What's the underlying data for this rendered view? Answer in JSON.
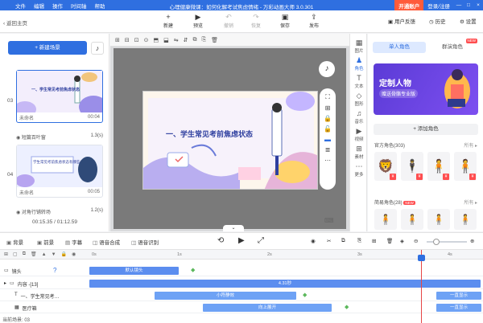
{
  "titlebar": {
    "menus": [
      "文件",
      "编辑",
      "操作",
      "时间轴",
      "帮助"
    ],
    "app_title": "心理健康微课：如何化解考试焦虑情绪 - 万彩动画大师 3.0.301",
    "upgrade": "开通账户",
    "login": "登录/注册",
    "win_min": "—",
    "win_max": "□",
    "win_close": "×"
  },
  "toolbar": {
    "back": "返回主页",
    "buttons": [
      {
        "label": "新建",
        "icon": "+"
      },
      {
        "label": "预览",
        "icon": "▶"
      },
      {
        "label": "撤销",
        "icon": "↶"
      },
      {
        "label": "恢复",
        "icon": "↷"
      },
      {
        "label": "保存",
        "icon": "▣"
      },
      {
        "label": "发布",
        "icon": "⇪"
      }
    ],
    "feedback": "用户反馈",
    "history": "历史",
    "settings": "设置"
  },
  "left": {
    "new_scene": "+ 新建场景",
    "scenes": [
      {
        "num": "03",
        "name": "未命名",
        "duration": "00:04",
        "transition": "短篇百叶窗",
        "trans_time": "1.3(s)"
      },
      {
        "num": "04",
        "name": "未命名",
        "duration": "00:05",
        "transition": "对角行铺转场",
        "trans_time": "1.2(s)"
      }
    ],
    "scene3_title": "一、学生常见考前焦虑状态",
    "scene4_title": "学生常见考前焦虑状态有哪些",
    "time_current": "00:15.35",
    "time_total": "/ 01:12.59"
  },
  "canvas": {
    "slide_title": "一、学生常见考前焦虑状态"
  },
  "categories": [
    {
      "label": "图片",
      "icon": "▦"
    },
    {
      "label": "角色",
      "icon": "♟"
    },
    {
      "label": "文本",
      "icon": "T"
    },
    {
      "label": "图形",
      "icon": "◇"
    },
    {
      "label": "音乐",
      "icon": "♫"
    },
    {
      "label": "视频",
      "icon": "▶"
    },
    {
      "label": "素材",
      "icon": "⊞"
    },
    {
      "label": "更多",
      "icon": "⋯"
    }
  ],
  "right": {
    "tab_single": "单人角色",
    "tab_group": "群演角色",
    "new_badge": "NEW",
    "banner_title": "定制人物",
    "banner_sub": "赠送骨骼专业版",
    "add_role": "+ 添加角色",
    "official": "官方角色(303)",
    "simple": "简易角色(28)",
    "more": "所有 ▸",
    "pay_badge": "¥"
  },
  "playbar": {
    "bg": "背景",
    "fg": "前景",
    "subtitle": "字幕",
    "tts": "语音合成",
    "asr": "语音识别"
  },
  "timeline": {
    "ruler": [
      "0s",
      "1s",
      "2s",
      "3s",
      "4s"
    ],
    "rows": [
      {
        "label": "镜头",
        "bar": "默认镜头"
      },
      {
        "label": "内容 -[13]",
        "bar": "4.31秒"
      },
      {
        "label": "一、学生常见考…",
        "bar": "小符静效",
        "end": "一直显示"
      },
      {
        "label": "医疗箱",
        "bar": "向上展开",
        "end": "一直显示"
      }
    ],
    "current_scene": "当前场景: 03"
  },
  "colors": {
    "accent": "#2f6fe0",
    "upgrade": "#ff5b3b",
    "bar": "#5b8def",
    "playhead": "#e64545"
  }
}
